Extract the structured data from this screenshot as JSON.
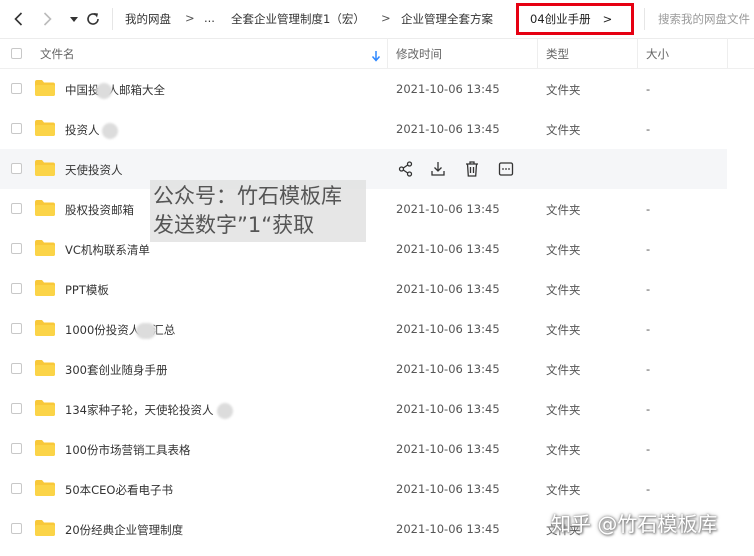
{
  "breadcrumb": {
    "root": "我的网盘",
    "ellipsis": "...",
    "level1": "全套企业管理制度1（宏）",
    "level2": "企业管理全套方案",
    "current": "04创业手册",
    "separator": ">"
  },
  "search": {
    "placeholder": "搜索我的网盘文件"
  },
  "columns": {
    "name": "文件名",
    "modified": "修改时间",
    "type": "类型",
    "size": "大小"
  },
  "rows": [
    {
      "name_a": "中国投",
      "name_b": "人邮箱大全",
      "modified": "2021-10-06 13:45",
      "type": "文件夹",
      "size": "-"
    },
    {
      "name_a": "投资人",
      "name_b": "",
      "modified": "2021-10-06 13:45",
      "type": "文件夹",
      "size": "-"
    },
    {
      "name_a": "天使投资人",
      "name_b": "",
      "modified": "",
      "type": "",
      "size": ""
    },
    {
      "name_a": "股权投资邮箱",
      "name_b": "",
      "modified": "2021-10-06 13:45",
      "type": "文件夹",
      "size": "-"
    },
    {
      "name_a": "VC机构联系清单",
      "name_b": "",
      "modified": "2021-10-06 13:45",
      "type": "文件夹",
      "size": "-"
    },
    {
      "name_a": "PPT模板",
      "name_b": "",
      "modified": "2021-10-06 13:45",
      "type": "文件夹",
      "size": "-"
    },
    {
      "name_a": "1000份投资人",
      "name_b": "汇总",
      "modified": "2021-10-06 13:45",
      "type": "文件夹",
      "size": "-"
    },
    {
      "name_a": "300套创业随身手册",
      "name_b": "",
      "modified": "2021-10-06 13:45",
      "type": "文件夹",
      "size": "-"
    },
    {
      "name_a": "134家种子轮，天使轮投资人",
      "name_b": "",
      "modified": "2021-10-06 13:45",
      "type": "文件夹",
      "size": "-"
    },
    {
      "name_a": "100份市场营销工具表格",
      "name_b": "",
      "modified": "2021-10-06 13:45",
      "type": "文件夹",
      "size": "-"
    },
    {
      "name_a": "50本CEO必看电子书",
      "name_b": "",
      "modified": "2021-10-06 13:45",
      "type": "文件夹",
      "size": "-"
    },
    {
      "name_a": "20份经典企业管理制度",
      "name_b": "",
      "modified": "2021-10-06 13:45",
      "type": "文件夹",
      "size": "-"
    }
  ],
  "overlay": {
    "line1": "公众号：竹石模板库",
    "line2": "发送数字”1“获取",
    "corner_watermark": "知乎 @竹石模板库"
  },
  "colors": {
    "folder": "#f8c83a",
    "highlight_border": "#e60012",
    "hover_row": "#f5f6f8"
  },
  "icons": [
    "back-arrow-icon",
    "forward-arrow-icon",
    "dropdown-triangle-icon",
    "refresh-icon",
    "sort-down-icon",
    "folder-icon",
    "share-icon",
    "download-icon",
    "delete-icon",
    "more-icon"
  ]
}
